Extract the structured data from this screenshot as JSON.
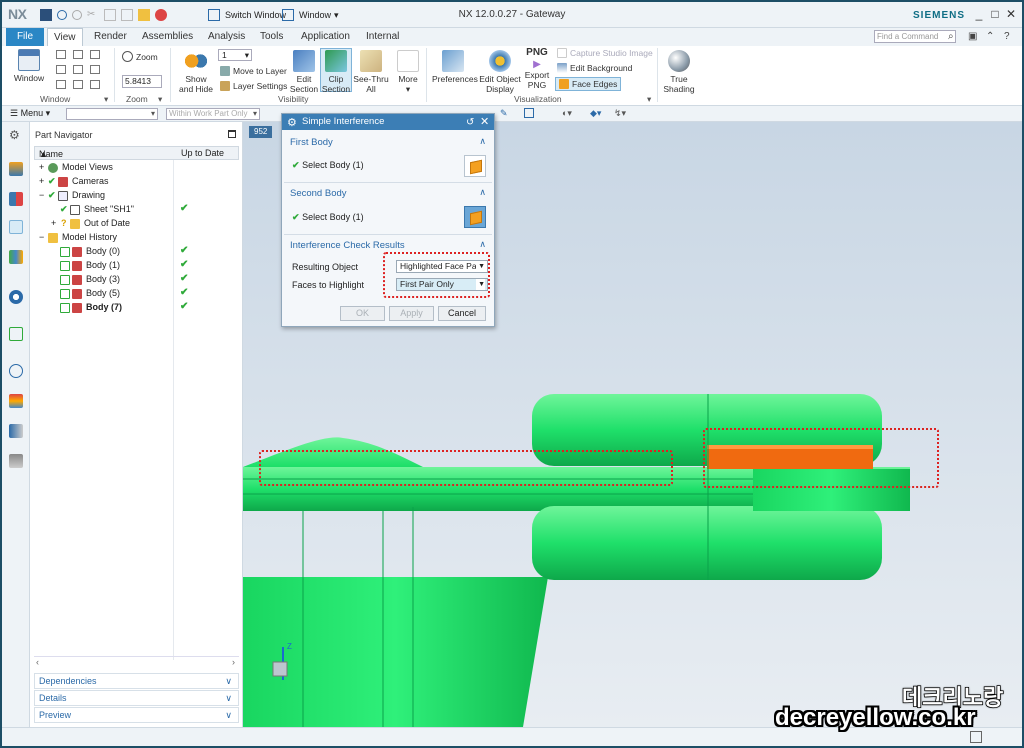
{
  "titlebar": {
    "logo": "NX",
    "switch_window": "Switch Window",
    "window_menu": "Window",
    "title": "NX 12.0.0.27 - Gateway",
    "brand": "SIEMENS",
    "minimize": "_",
    "maximize": "□",
    "close": "✕"
  },
  "tabs": {
    "items": [
      "File",
      "View",
      "Render",
      "Assemblies",
      "Analysis",
      "Tools",
      "Application",
      "Internal"
    ],
    "active": "View",
    "find_placeholder": "Find a Command"
  },
  "ribbon": {
    "window_btn": "Window",
    "window_group": "Window",
    "zoom_btn": "Zoom",
    "zoom_value": "5.8413",
    "zoom_group": "Zoom",
    "layer_value": "1",
    "show_hide": [
      "Show",
      "and Hide"
    ],
    "move_to_layer": "Move to Layer",
    "layer_settings": "Layer Settings",
    "edit_section": [
      "Edit",
      "Section"
    ],
    "clip_section": [
      "Clip",
      "Section"
    ],
    "see_thru": [
      "See-Thru",
      "All"
    ],
    "more": "More",
    "visibility_group": "Visibility",
    "preferences": "Preferences",
    "edit_object_display": [
      "Edit Object",
      "Display"
    ],
    "png_label": "PNG",
    "export_png": [
      "Export",
      "PNG"
    ],
    "capture_studio": "Capture Studio Image",
    "edit_background": "Edit Background",
    "face_edges": "Face Edges",
    "visualization_group": "Visualization",
    "true_shading": [
      "True",
      "Shading"
    ]
  },
  "toolbar2": {
    "menu": "Menu",
    "filter_placeholder": "Within Work Part Only"
  },
  "navigator": {
    "title": "Part Navigator",
    "col_name": "Name",
    "col_status": "Up to Date",
    "rows": [
      {
        "label": "Model Views",
        "check": ""
      },
      {
        "label": "Cameras",
        "check": ""
      },
      {
        "label": "Drawing",
        "check": ""
      },
      {
        "label": "Sheet \"SH1\"",
        "check": "✔"
      },
      {
        "label": "Out of Date",
        "check": ""
      },
      {
        "label": "Model History",
        "check": ""
      },
      {
        "label": "Body (0)",
        "check": "✔"
      },
      {
        "label": "Body (1)",
        "check": "✔"
      },
      {
        "label": "Body (3)",
        "check": "✔"
      },
      {
        "label": "Body (5)",
        "check": "✔"
      },
      {
        "label": "Body (7)",
        "check": "✔"
      }
    ],
    "panels": [
      "Dependencies",
      "Details",
      "Preview"
    ]
  },
  "graphics": {
    "tab_label": "952"
  },
  "dialog": {
    "title": "Simple Interference",
    "first_body": "First Body",
    "first_select": "Select Body (1)",
    "second_body": "Second Body",
    "second_select": "Select Body (1)",
    "results_header": "Interference Check Results",
    "resulting_object_label": "Resulting Object",
    "resulting_object_value": "Highlighted Face Pair",
    "faces_label": "Faces to Highlight",
    "faces_value": "First Pair Only",
    "ok": "OK",
    "apply": "Apply",
    "cancel": "Cancel"
  },
  "watermark": {
    "line1": "데크리노랑",
    "line2": "decreyellow.co.kr"
  },
  "colors": {
    "model_green": "#1fe06a",
    "interference_orange": "#f06a10",
    "annotation_red": "#dd2222",
    "dialog_title": "#3c7eb5"
  }
}
